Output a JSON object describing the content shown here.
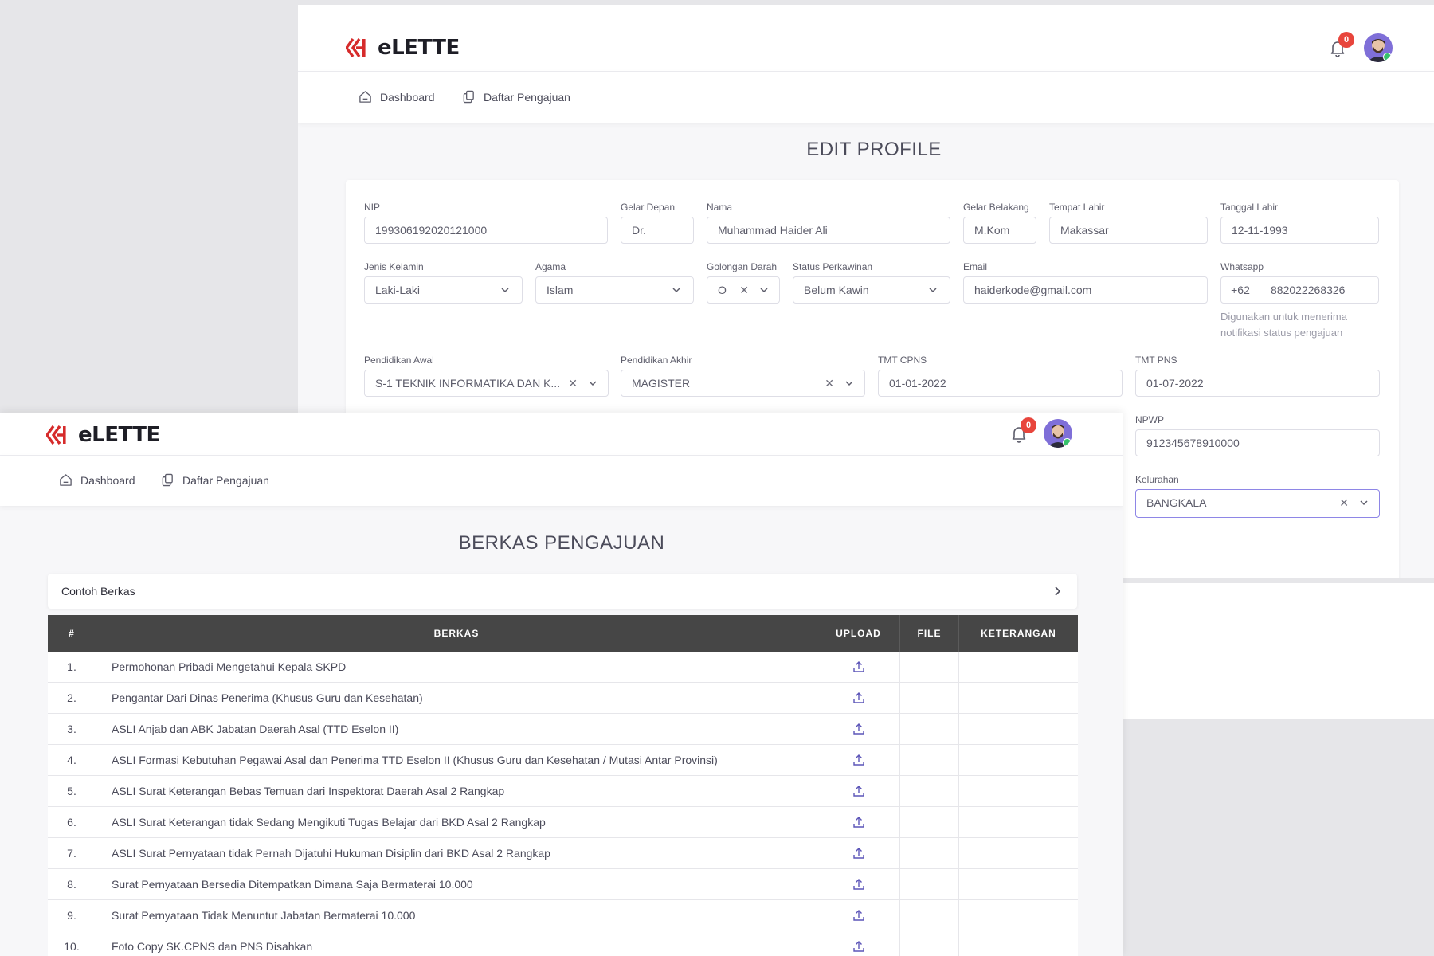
{
  "app": {
    "brand": "eLETTE",
    "notification_count": "0"
  },
  "nav": {
    "items": [
      {
        "label": "Dashboard",
        "icon": "home-icon"
      },
      {
        "label": "Daftar Pengajuan",
        "icon": "copy-icon"
      }
    ]
  },
  "edit_profile": {
    "title": "EDIT PROFILE",
    "fields": {
      "nip": {
        "label": "NIP",
        "value": "199306192020121000"
      },
      "gelar_depan": {
        "label": "Gelar Depan",
        "value": "Dr."
      },
      "nama": {
        "label": "Nama",
        "value": "Muhammad Haider Ali"
      },
      "gelar_belakang": {
        "label": "Gelar Belakang",
        "value": "M.Kom"
      },
      "tempat_lahir": {
        "label": "Tempat Lahir",
        "value": "Makassar"
      },
      "tanggal_lahir": {
        "label": "Tanggal Lahir",
        "value": "12-11-1993"
      },
      "jenis_kelamin": {
        "label": "Jenis Kelamin",
        "value": "Laki-Laki"
      },
      "agama": {
        "label": "Agama",
        "value": "Islam"
      },
      "golongan_darah": {
        "label": "Golongan Darah",
        "value": "O"
      },
      "status_perkawinan": {
        "label": "Status Perkawinan",
        "value": "Belum Kawin"
      },
      "email": {
        "label": "Email",
        "value": "haiderkode@gmail.com"
      },
      "whatsapp": {
        "label": "Whatsapp",
        "prefix": "+62",
        "value": "882022268326",
        "hint_line1": "Digunakan untuk menerima",
        "hint_line2": "notifikasi status pengajuan"
      },
      "pendidikan_awal": {
        "label": "Pendidikan Awal",
        "value": "S-1 TEKNIK INFORMATIKA DAN K..."
      },
      "pendidikan_akhir": {
        "label": "Pendidikan Akhir",
        "value": "MAGISTER"
      },
      "tmt_cpns": {
        "label": "TMT CPNS",
        "value": "01-01-2022"
      },
      "tmt_pns": {
        "label": "TMT PNS",
        "value": "01-07-2022"
      },
      "npwp": {
        "label": "NPWP",
        "value": "912345678910000"
      },
      "kelurahan": {
        "label": "Kelurahan",
        "value": "BANGKALA"
      }
    }
  },
  "berkas": {
    "title": "BERKAS PENGAJUAN",
    "accordion_label": "Contoh Berkas",
    "columns": [
      "#",
      "BERKAS",
      "UPLOAD",
      "FILE",
      "KETERANGAN"
    ],
    "rows": [
      {
        "no": "1.",
        "name": "Permohonan Pribadi Mengetahui Kepala SKPD"
      },
      {
        "no": "2.",
        "name": "Pengantar Dari Dinas Penerima (Khusus Guru dan Kesehatan)"
      },
      {
        "no": "3.",
        "name": "ASLI Anjab dan ABK Jabatan Daerah Asal (TTD Eselon II)"
      },
      {
        "no": "4.",
        "name": "ASLI Formasi Kebutuhan Pegawai Asal dan Penerima TTD Eselon II (Khusus Guru dan Kesehatan / Mutasi Antar Provinsi)"
      },
      {
        "no": "5.",
        "name": "ASLI Surat Keterangan Bebas Temuan dari Inspektorat Daerah Asal 2 Rangkap"
      },
      {
        "no": "6.",
        "name": "ASLI Surat Keterangan tidak Sedang Mengikuti Tugas Belajar dari BKD Asal 2 Rangkap"
      },
      {
        "no": "7.",
        "name": "ASLI Surat Pernyataan tidak Pernah Dijatuhi Hukuman Disiplin dari BKD Asal 2 Rangkap"
      },
      {
        "no": "8.",
        "name": "Surat Pernyataan Bersedia Ditempatkan Dimana Saja Bermaterai 10.000"
      },
      {
        "no": "9.",
        "name": "Surat Pernyataan Tidak Menuntut Jabatan Bermaterai 10.000"
      },
      {
        "no": "10.",
        "name": "Foto Copy SK.CPNS dan PNS Disahkan"
      }
    ]
  },
  "colors": {
    "accent": "#7367f0",
    "badge": "#e8453c",
    "logo_red": "#d62b2b",
    "table_header": "#464646",
    "online": "#36c26b"
  }
}
